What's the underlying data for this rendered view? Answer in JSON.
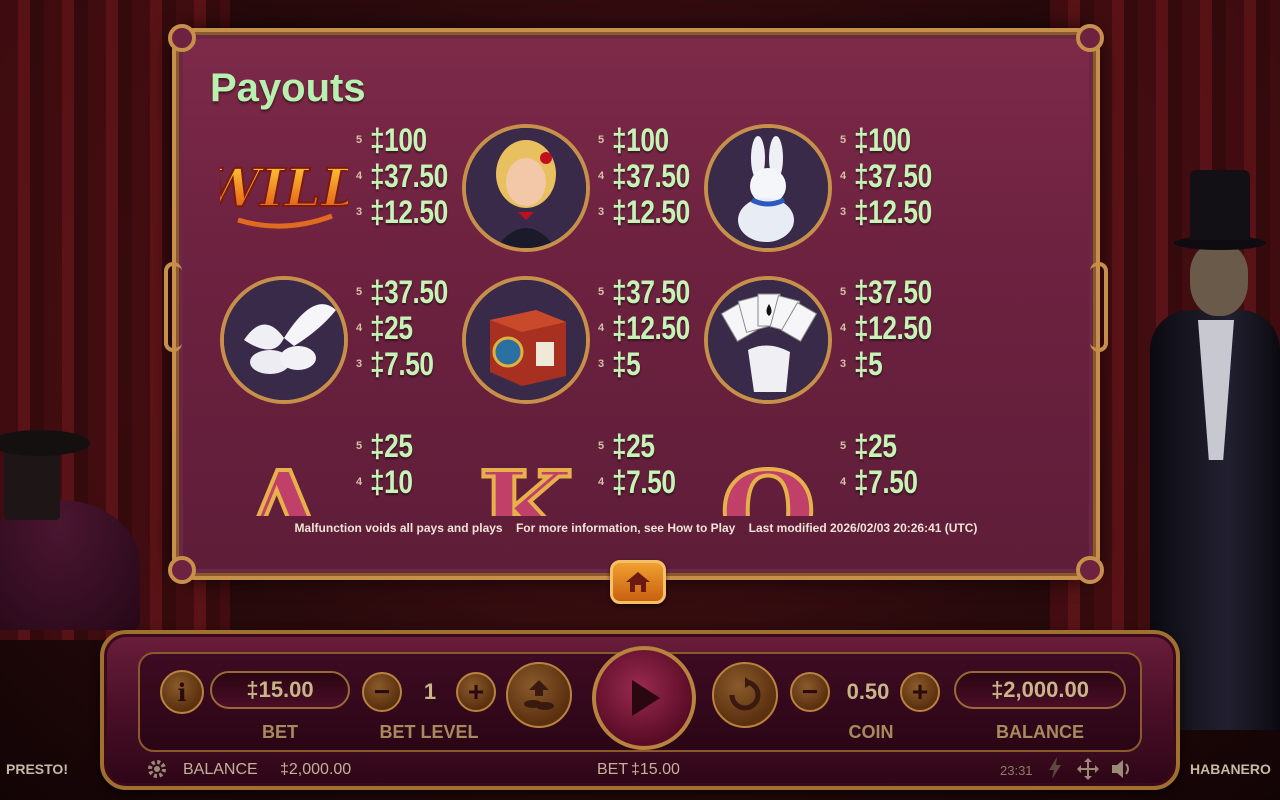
{
  "modal": {
    "title": "Payouts",
    "footer": {
      "malfunction": "Malfunction voids all pays and plays",
      "more_info": "For more information, see How to Play",
      "last_modified": "Last modified 2026/02/03 20:26:41 (UTC)"
    },
    "home_icon": "home-icon"
  },
  "symbols": [
    {
      "name": "WILD",
      "art": "wild-logo",
      "payouts": [
        {
          "count": "5",
          "amount": "‡100"
        },
        {
          "count": "4",
          "amount": "‡37.50"
        },
        {
          "count": "3",
          "amount": "‡12.50"
        }
      ]
    },
    {
      "name": "assistant",
      "art": "assistant-portrait",
      "payouts": [
        {
          "count": "5",
          "amount": "‡100"
        },
        {
          "count": "4",
          "amount": "‡37.50"
        },
        {
          "count": "3",
          "amount": "‡12.50"
        }
      ]
    },
    {
      "name": "rabbit",
      "art": "rabbit-portrait",
      "payouts": [
        {
          "count": "5",
          "amount": "‡100"
        },
        {
          "count": "4",
          "amount": "‡37.50"
        },
        {
          "count": "3",
          "amount": "‡12.50"
        }
      ]
    },
    {
      "name": "doves",
      "art": "doves-portrait",
      "payouts": [
        {
          "count": "5",
          "amount": "‡37.50"
        },
        {
          "count": "4",
          "amount": "‡25"
        },
        {
          "count": "3",
          "amount": "‡7.50"
        }
      ]
    },
    {
      "name": "magic-box",
      "art": "magic-box-portrait",
      "payouts": [
        {
          "count": "5",
          "amount": "‡37.50"
        },
        {
          "count": "4",
          "amount": "‡12.50"
        },
        {
          "count": "3",
          "amount": "‡5"
        }
      ]
    },
    {
      "name": "cards",
      "art": "cards-portrait",
      "payouts": [
        {
          "count": "5",
          "amount": "‡37.50"
        },
        {
          "count": "4",
          "amount": "‡12.50"
        },
        {
          "count": "3",
          "amount": "‡5"
        }
      ]
    },
    {
      "name": "A",
      "art": "letter-a",
      "payouts": [
        {
          "count": "5",
          "amount": "‡25"
        },
        {
          "count": "4",
          "amount": "‡10"
        }
      ]
    },
    {
      "name": "K",
      "art": "letter-k",
      "payouts": [
        {
          "count": "5",
          "amount": "‡25"
        },
        {
          "count": "4",
          "amount": "‡7.50"
        }
      ]
    },
    {
      "name": "Q",
      "art": "letter-q",
      "payouts": [
        {
          "count": "5",
          "amount": "‡25"
        },
        {
          "count": "4",
          "amount": "‡7.50"
        }
      ]
    }
  ],
  "controls": {
    "bet_value": "‡15.00",
    "bet_label": "BET",
    "bet_level_value": "1",
    "bet_level_label": "BET LEVEL",
    "coin_value": "0.50",
    "coin_label": "COIN",
    "balance_value": "‡2,000.00",
    "balance_label": "BALANCE",
    "minus_glyph": "−",
    "plus_glyph": "+"
  },
  "status_bar": {
    "left_brand": "PRESTO!",
    "balance_label": "BALANCE",
    "balance_value": "‡2,000.00",
    "bet_label": "BET",
    "bet_value": "‡15.00",
    "clock": "23:31",
    "right_brand": "HABANERO"
  },
  "colors": {
    "payout_green": "#c6f4b6",
    "title_green": "#b8f0b0",
    "gold_frame": "#c7904a",
    "modal_bg": "#6d2240",
    "home_orange": "#e08a20"
  }
}
